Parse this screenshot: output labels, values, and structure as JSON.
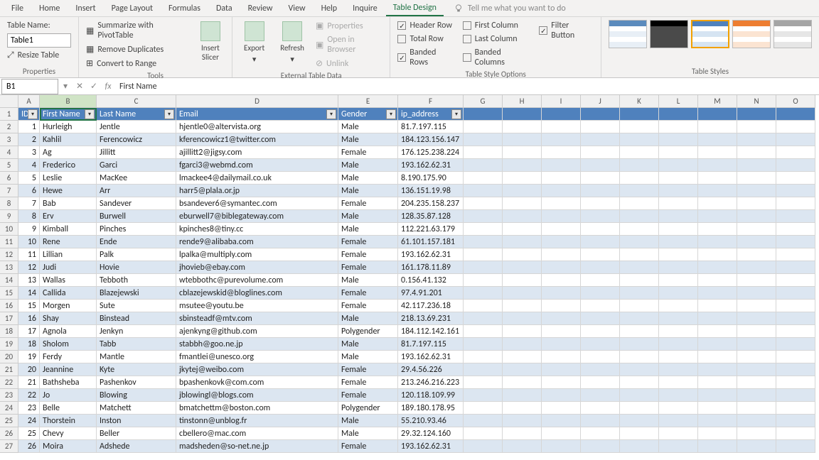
{
  "menu": {
    "items": [
      "File",
      "Home",
      "Insert",
      "Page Layout",
      "Formulas",
      "Data",
      "Review",
      "View",
      "Help",
      "Inquire",
      "Table Design"
    ],
    "active": "Table Design",
    "tellme": "Tell me what you want to do"
  },
  "ribbon": {
    "properties": {
      "label": "Properties",
      "tablename_label": "Table Name:",
      "tablename_value": "Table1",
      "resize": "Resize Table"
    },
    "tools": {
      "label": "Tools",
      "pivot": "Summarize with PivotTable",
      "dup": "Remove Duplicates",
      "range": "Convert to Range",
      "slicer": "Insert\nSlicer"
    },
    "ext": {
      "label": "External Table Data",
      "export": "Export",
      "refresh": "Refresh",
      "props": "Properties",
      "browser": "Open in Browser",
      "unlink": "Unlink"
    },
    "opts": {
      "label": "Table Style Options",
      "hrow": "Header Row",
      "trow": "Total Row",
      "brow": "Banded Rows",
      "fcol": "First Column",
      "lcol": "Last Column",
      "bcol": "Banded Columns",
      "filt": "Filter Button"
    },
    "styles": {
      "label": "Table Styles"
    }
  },
  "namebox": "B1",
  "formula": "First Name",
  "columns": [
    "A",
    "B",
    "C",
    "D",
    "E",
    "F",
    "G",
    "H",
    "I",
    "J",
    "K",
    "L",
    "M",
    "N",
    "O"
  ],
  "headers": [
    "ID",
    "First Name",
    "Last Name",
    "Email",
    "Gender",
    "ip_address"
  ],
  "rows": [
    [
      1,
      "Hurleigh",
      "Jentle",
      "hjentle0@altervista.org",
      "Male",
      "81.7.197.115"
    ],
    [
      2,
      "Kahlil",
      "Ferencowicz",
      "kferencowicz1@twitter.com",
      "Male",
      "184.123.156.147"
    ],
    [
      3,
      "Ag",
      "Jillitt",
      "ajillitt2@jigsy.com",
      "Female",
      "176.125.238.224"
    ],
    [
      4,
      "Frederico",
      "Garci",
      "fgarci3@webmd.com",
      "Male",
      "193.162.62.31"
    ],
    [
      5,
      "Leslie",
      "MacKee",
      "lmackee4@dailymail.co.uk",
      "Male",
      "8.190.175.90"
    ],
    [
      6,
      "Hewe",
      "Arr",
      "harr5@plala.or.jp",
      "Male",
      "136.151.19.98"
    ],
    [
      7,
      "Bab",
      "Sandever",
      "bsandever6@symantec.com",
      "Female",
      "204.235.158.237"
    ],
    [
      8,
      "Erv",
      "Burwell",
      "eburwell7@biblegateway.com",
      "Male",
      "128.35.87.128"
    ],
    [
      9,
      "Kimball",
      "Pinches",
      "kpinches8@tiny.cc",
      "Male",
      "112.221.63.179"
    ],
    [
      10,
      "Rene",
      "Ende",
      "rende9@alibaba.com",
      "Female",
      "61.101.157.181"
    ],
    [
      11,
      "Lillian",
      "Palk",
      "lpalka@multiply.com",
      "Female",
      "193.162.62.31"
    ],
    [
      12,
      "Judi",
      "Hovie",
      "jhovieb@ebay.com",
      "Female",
      "161.178.11.89"
    ],
    [
      13,
      "Wallas",
      "Tebboth",
      "wtebbothc@purevolume.com",
      "Male",
      "0.156.41.132"
    ],
    [
      14,
      "Callida",
      "Blazejewski",
      "cblazejewskid@bloglines.com",
      "Female",
      "97.4.91.201"
    ],
    [
      15,
      "Morgen",
      "Sute",
      "msutee@youtu.be",
      "Female",
      "42.117.236.18"
    ],
    [
      16,
      "Shay",
      "Binstead",
      "sbinsteadf@mtv.com",
      "Male",
      "218.13.69.231"
    ],
    [
      17,
      "Agnola",
      "Jenkyn",
      "ajenkyng@github.com",
      "Polygender",
      "184.112.142.161"
    ],
    [
      18,
      "Sholom",
      "Tabb",
      "stabbh@goo.ne.jp",
      "Male",
      "81.7.197.115"
    ],
    [
      19,
      "Ferdy",
      "Mantle",
      "fmantlei@unesco.org",
      "Male",
      "193.162.62.31"
    ],
    [
      20,
      "Jeannine",
      "Kyte",
      "jkytej@weibo.com",
      "Female",
      "29.4.56.226"
    ],
    [
      21,
      "Bathsheba",
      "Pashenkov",
      "bpashenkovk@com.com",
      "Female",
      "213.246.216.223"
    ],
    [
      22,
      "Jo",
      "Blowing",
      "jblowingl@blogs.com",
      "Female",
      "120.118.109.99"
    ],
    [
      23,
      "Belle",
      "Matchett",
      "bmatchettm@boston.com",
      "Polygender",
      "189.180.178.95"
    ],
    [
      24,
      "Thorstein",
      "Inston",
      "tinstonn@unblog.fr",
      "Male",
      "55.210.93.46"
    ],
    [
      25,
      "Chevy",
      "Beller",
      "cbellero@mac.com",
      "Male",
      "29.32.124.160"
    ],
    [
      26,
      "Moira",
      "Adshede",
      "madsheden@so-net.ne.jp",
      "Female",
      "193.162.62.31"
    ]
  ]
}
